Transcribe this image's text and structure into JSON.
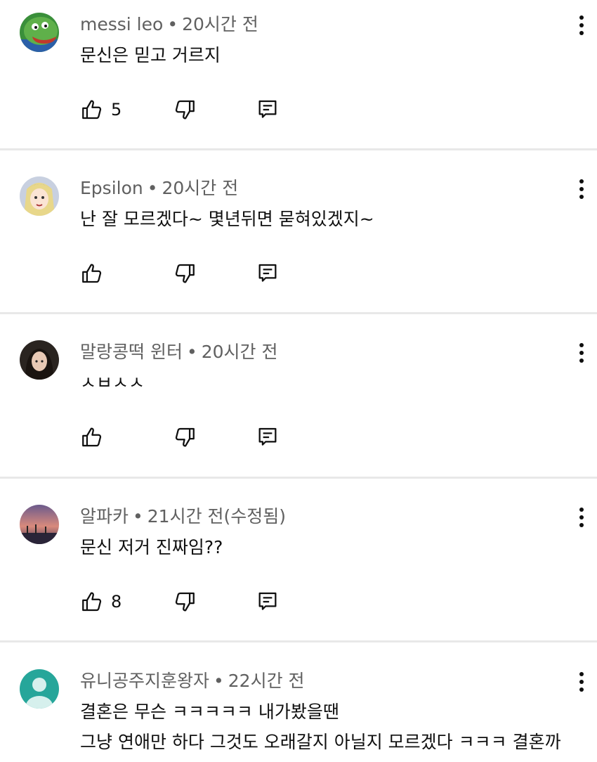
{
  "comments": [
    {
      "author": "messi leo",
      "time": "20시간 전",
      "lines": [
        "문신은 믿고 거르지"
      ],
      "likes": "5"
    },
    {
      "author": "Epsilon",
      "time": "20시간 전",
      "lines": [
        "난 잘 모르겠다~  몇년뒤면 묻혀있겠지~"
      ],
      "likes": ""
    },
    {
      "author": "말랑콩떡 윈터",
      "time": "20시간 전",
      "lines": [
        "ㅅㅂㅅㅅ"
      ],
      "likes": ""
    },
    {
      "author": "알파카",
      "time": "21시간 전(수정됨)",
      "lines": [
        "문신 저거 진짜임??"
      ],
      "likes": "8"
    },
    {
      "author": "유니공주지훈왕자",
      "time": "22시간 전",
      "lines": [
        "결혼은 무슨 ㅋㅋㅋㅋㅋ 내가봤을땐",
        "그냥 연애만 하다 그것도 오래갈지 아닐지 모르겠다 ㅋㅋㅋ 결혼까"
      ],
      "likes": ""
    }
  ],
  "separator": "•",
  "icons": {
    "like": "thumb-up-icon",
    "dislike": "thumb-down-icon",
    "reply": "reply-icon",
    "more": "more-vert-icon"
  },
  "colors": {
    "meta": "#606060",
    "text": "#0f0f0f",
    "divider": "#e8e8e8",
    "default_avatar": "#26a69a"
  }
}
